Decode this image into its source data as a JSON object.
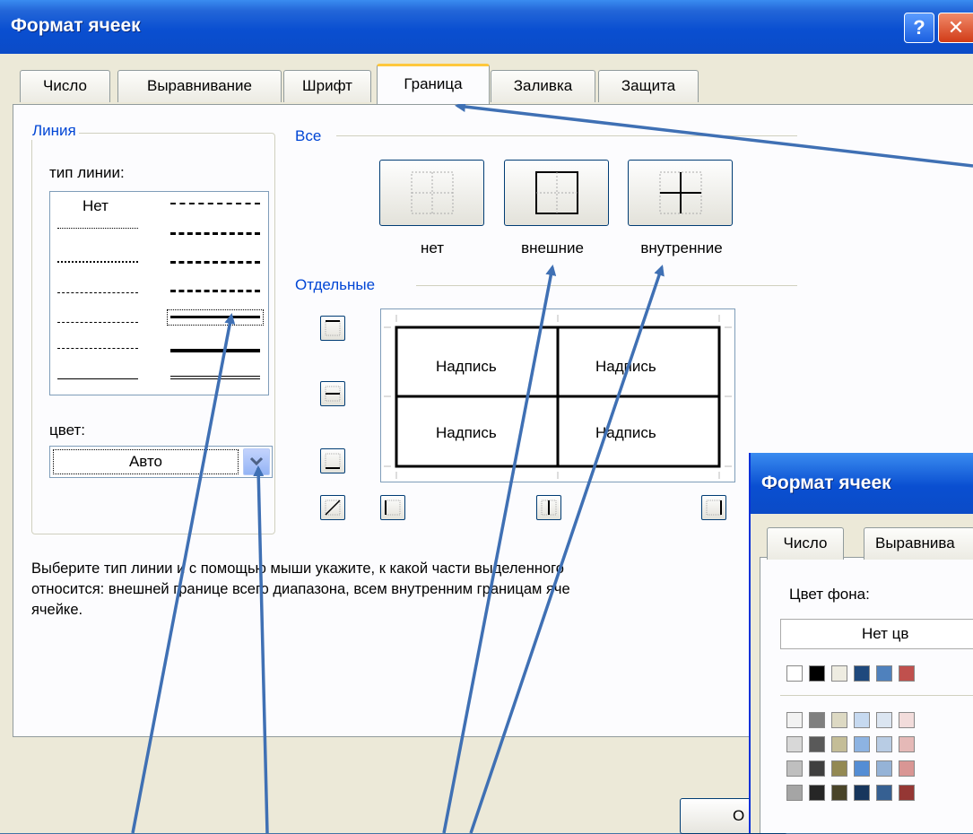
{
  "window": {
    "title": "Формат ячеек",
    "help_glyph": "?",
    "close_glyph": "✕",
    "tabs": [
      {
        "label": "Число",
        "active": false
      },
      {
        "label": "Выравнивание",
        "active": false
      },
      {
        "label": "Шрифт",
        "active": false
      },
      {
        "label": "Граница",
        "active": true
      },
      {
        "label": "Заливка",
        "active": false
      },
      {
        "label": "Защита",
        "active": false
      }
    ]
  },
  "line_group": {
    "legend": "Линия",
    "line_type_label": "тип линии:",
    "none_label": "Нет",
    "color_label": "цвет:",
    "color_value": "Авто"
  },
  "presets": {
    "legend": "Все",
    "items": [
      {
        "label": "нет"
      },
      {
        "label": "внешние"
      },
      {
        "label": "внутренние"
      }
    ]
  },
  "individual": {
    "legend": "Отдельные",
    "cell_text": "Надпись"
  },
  "description": "Выберите тип линии и с помощью мыши укажите, к какой части выделенного диапазона он относится: внешней границе всего диапазона, всем внутренним границам ячеек или отдельной ячейке.",
  "description_lines": [
    "Выберите тип линии и с помощью мыши укажите, к какой части выделенного",
    "относится: внешней границе всего диапазона, всем внутренним границам яче",
    "ячейке."
  ],
  "ok_button": "О",
  "second_window": {
    "title": "Формат ячеек",
    "tabs": [
      "Число",
      "Выравнива"
    ],
    "bg_color_label": "Цвет фона:",
    "no_color_value": "Нет цв",
    "swatch_rows": [
      [
        "#ffffff",
        "#000000",
        "#eeece1",
        "#1f497d",
        "#4f81bd",
        "#c0504d"
      ],
      [
        "#f2f2f2",
        "#7f7f7f",
        "#ddd9c3",
        "#c6d9f0",
        "#dbe5f1",
        "#f2dcdb"
      ],
      [
        "#d8d8d8",
        "#595959",
        "#c4bd97",
        "#8db3e2",
        "#b8cce4",
        "#e5b9b7"
      ],
      [
        "#bfbfbf",
        "#3f3f3f",
        "#938953",
        "#548dd4",
        "#95b3d7",
        "#d99694"
      ],
      [
        "#a5a5a5",
        "#262626",
        "#494429",
        "#17365d",
        "#366092",
        "#953734"
      ]
    ]
  },
  "colors": {
    "title_bar": "#0a4fd1",
    "accent_blue": "#0046d5",
    "dialog_bg": "#ece9d8",
    "arrow": "#3f70b4"
  }
}
